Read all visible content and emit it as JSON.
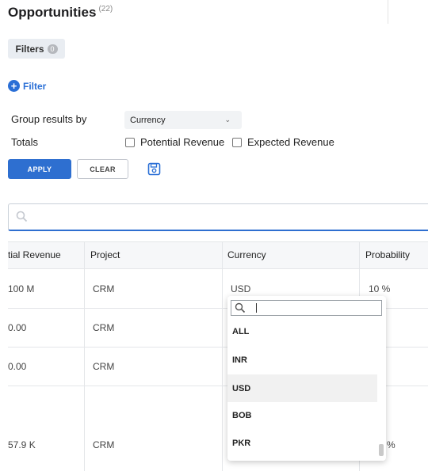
{
  "page": {
    "title": "Opportunities",
    "count": "(22)"
  },
  "filters": {
    "label": "Filters",
    "count": "0",
    "add_filter": "Filter"
  },
  "group": {
    "label": "Group results by",
    "value": "Currency"
  },
  "totals": {
    "label": "Totals",
    "options": [
      "Potential Revenue",
      "Expected Revenue"
    ]
  },
  "buttons": {
    "apply": "APPLY",
    "clear": "CLEAR"
  },
  "search": {
    "placeholder": ""
  },
  "table": {
    "columns": [
      "tial Revenue",
      "Project",
      "Currency",
      "Probability"
    ],
    "rows": [
      {
        "revenue": "100 M",
        "project": "CRM",
        "currency": "USD",
        "probability": "10 %"
      },
      {
        "revenue": "0.00",
        "project": "CRM",
        "currency": "",
        "probability": ""
      },
      {
        "revenue": "0.00",
        "project": "CRM",
        "currency": "",
        "probability": ""
      },
      {
        "revenue": "57.9 K",
        "project": "CRM",
        "currency": "",
        "probability": "%"
      }
    ]
  },
  "currency_dropdown": {
    "search_value": "",
    "options": [
      "ALL",
      "INR",
      "USD",
      "BOB",
      "PKR"
    ],
    "selected": "USD"
  },
  "colors": {
    "accent": "#2e6fd0",
    "link": "#2a6fd6"
  }
}
